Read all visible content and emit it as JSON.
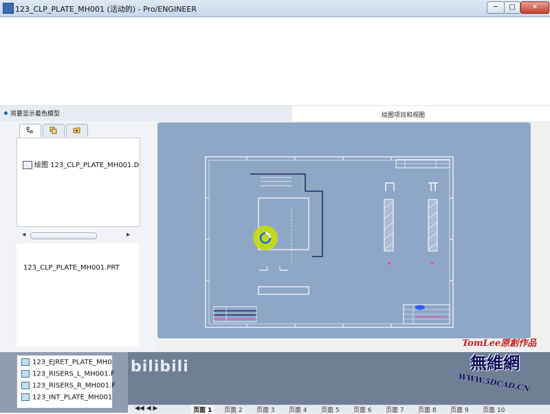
{
  "window": {
    "title": "123_CLP_PLATE_MH001 (活动的) - Pro/ENGINEER",
    "minimize_glyph": "─",
    "maximize_glyph": "□",
    "close_glyph": "✕"
  },
  "status": {
    "message": "将要显示着色模型",
    "preview_label": "绘图项目和视图"
  },
  "left_panel": {
    "tabs": [
      {
        "icon": "model-tree-icon",
        "active": true
      },
      {
        "icon": "layers-icon",
        "active": false
      },
      {
        "icon": "folder-icon",
        "active": false
      }
    ],
    "tree_item": "绘图 123_CLP_PLATE_MH001.D",
    "model_name": "123_CLP_PLATE_MH001.PRT"
  },
  "file_list": {
    "items": [
      "123_EJRET_PLATE_MH0",
      "123_RISERS_L_MH001.F",
      "123_RISERS_R_MH001.F",
      "123_INT_PLATE_MH001"
    ]
  },
  "pagebar": {
    "tabs": [
      {
        "label": "页面 1",
        "active": true
      },
      {
        "label": "页面 2",
        "active": false
      },
      {
        "label": "页面 3",
        "active": false
      },
      {
        "label": "页面 4",
        "active": false
      },
      {
        "label": "页面 5",
        "active": false
      },
      {
        "label": "页面 6",
        "active": false
      },
      {
        "label": "页面 7",
        "active": false
      },
      {
        "label": "页面 8",
        "active": false
      },
      {
        "label": "页面 9",
        "active": false
      },
      {
        "label": "页面 10",
        "active": false
      }
    ]
  },
  "watermark": {
    "bilibili": "bilibili",
    "author": "TomLee原創作品",
    "site_name": "無維網",
    "url": "WWW.5DCAD.CN"
  },
  "colors": {
    "preview_bg": "#8fa7c6",
    "loading_ring": "#c8e000",
    "watermark_red": "#c21f1f",
    "watermark_navy": "#0b0b5a"
  }
}
